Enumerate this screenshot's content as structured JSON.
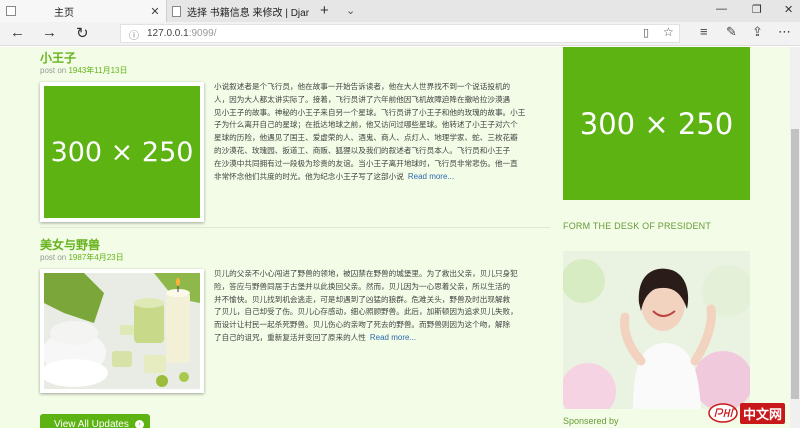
{
  "browser": {
    "tabs": [
      {
        "label": "主页",
        "active": true
      },
      {
        "label": "选择 书籍信息 来修改 | Djar",
        "active": false
      }
    ],
    "new_tab": "+",
    "tab_list": "⌄",
    "window_controls": {
      "minimize": "—",
      "restore": "❐",
      "close": "✕"
    },
    "nav": {
      "back": "←",
      "forward": "→",
      "refresh": "↻"
    },
    "url": {
      "host": "127.0.0.1",
      "port": ":9099/"
    },
    "tools": {
      "favorites": "☆",
      "hub": "≡",
      "notes": "✎",
      "share": "⇪",
      "more": "⋯"
    }
  },
  "posts": [
    {
      "title": "小王子",
      "meta_prefix": "post on",
      "date": "1943年11月13日",
      "image_text": "300 × 250",
      "lines": [
        "小说叙述者是个飞行员，他在故事一开始告诉读者，他在大人世界找不到一个说话投机的",
        "人，因为大人都太讲实际了。接着，飞行员讲了六年前他因飞机故障迫降在撒哈拉沙漠遇",
        "见小王子的故事。神秘的小王子来自另一个星球。飞行员讲了小王子和他的玫瑰的故事。小王",
        "子为什么离开自己的星球；在抵达地球之前，他又访问过哪些星球。他转述了小王子对六个",
        "星球的历险，他遇见了国王、爱虚荣的人、酒鬼、商人、点灯人、地理学家、蛇、三枚花瓣",
        "的沙漠花、玫瑰园、扳道工、商贩、狐狸以及我们的叙述者飞行员本人。飞行员和小王子",
        "在沙漠中共同拥有过一段极为珍贵的友谊。当小王子离开地球时，飞行员非常悲伤。他一直",
        "非常怀念他们共度的时光。他为纪念小王子写了这部小说"
      ],
      "read_more": "Read more..."
    },
    {
      "title": "美女与野兽",
      "meta_prefix": "post on",
      "date": "1987年4月23日",
      "lines": [
        "贝儿的父亲不小心闯进了野兽的领地，被囚禁在野兽的城堡里。为了救出父亲，贝儿只身犯",
        "险，答应与野兽同居于古堡并以此换回父亲。然而，贝儿因为一心思着父亲，所以生活的",
        "并不愉快。贝儿找到机会逃走，可是却遇到了凶猛的狼群。危难关头，野兽及时出现解救",
        "了贝儿，自己却受了伤。贝儿心存感动，细心照顾野兽。此后，加斯顿因为追求贝儿失败，",
        "而设计让村民一起杀死野兽。贝儿伤心的亲吻了死去的野兽。而野兽则因为这个吻，解除",
        "了自己的诅咒，重新复活并变回了原来的人性"
      ],
      "read_more": "Read more..."
    }
  ],
  "view_all": {
    "label": "View All Updates",
    "icon": "›"
  },
  "sidebar": {
    "ad_text": "300 × 250",
    "heading": "FORM THE DESK OF PRESIDENT",
    "sponsored": "Sponsered by"
  },
  "watermark": {
    "text": "中文网"
  },
  "colors": {
    "accent": "#5cb312",
    "page_bg": "#f2fce6",
    "link": "#2e6ab0"
  }
}
